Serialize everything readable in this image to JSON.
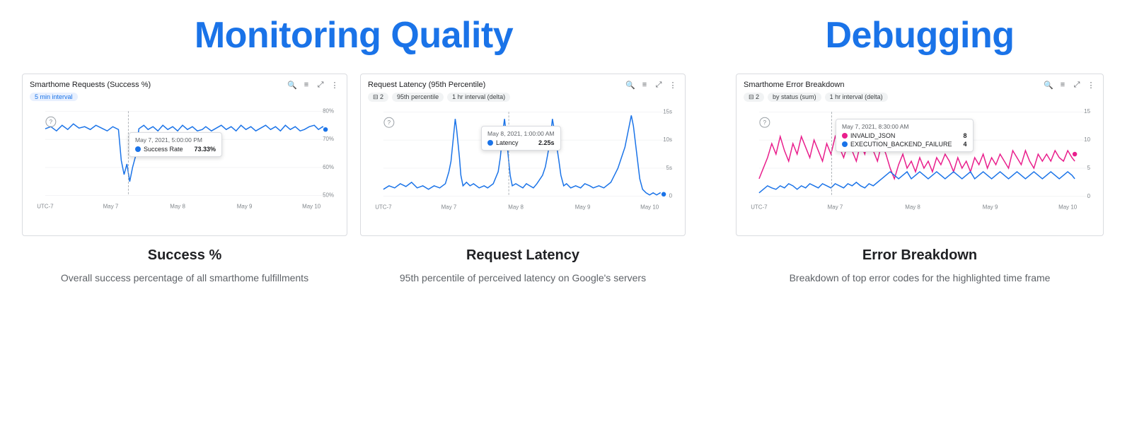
{
  "monitoring": {
    "title": "Monitoring Quality",
    "charts": [
      {
        "id": "success-rate",
        "title": "Smarthome Requests (Success %)",
        "pills": [
          "5 min interval"
        ],
        "caption_title": "Success %",
        "caption_desc": "Overall success percentage of all smarthome fulfillments",
        "tooltip_date": "May 7, 2021, 5:00:00 PM",
        "tooltip_label": "Success Rate",
        "tooltip_value": "73.33%",
        "y_labels": [
          "80%",
          "70%",
          "60%",
          "50%"
        ],
        "x_labels": [
          "UTC-7",
          "May 7",
          "May 8",
          "May 9",
          "May 10"
        ]
      },
      {
        "id": "request-latency",
        "title": "Request Latency (95th Percentile)",
        "pills": [
          "2",
          "95th percentile",
          "1 hr interval (delta)"
        ],
        "caption_title": "Request Latency",
        "caption_desc": "95th percentile of perceived latency on Google's servers",
        "tooltip_date": "May 8, 2021, 1:00:00 AM",
        "tooltip_label": "Latency",
        "tooltip_value": "2.25s",
        "y_labels": [
          "15s",
          "10s",
          "5s",
          "0"
        ],
        "x_labels": [
          "UTC-7",
          "May 7",
          "May 8",
          "May 9",
          "May 10"
        ]
      }
    ]
  },
  "debugging": {
    "title": "Debugging",
    "chart": {
      "id": "error-breakdown",
      "title": "Smarthome Error Breakdown",
      "pills": [
        "2",
        "by status (sum)",
        "1 hr interval (delta)"
      ],
      "caption_title": "Error Breakdown",
      "caption_desc": "Breakdown of top error codes for the highlighted time frame",
      "tooltip_date": "May 7, 2021, 8:30:00 AM",
      "tooltip_rows": [
        {
          "label": "INVALID_JSON",
          "value": "8",
          "color": "#e91e8c"
        },
        {
          "label": "EXECUTION_BACKEND_FAILURE",
          "value": "4",
          "color": "#1a73e8"
        }
      ],
      "y_labels": [
        "15",
        "10",
        "5",
        "0"
      ],
      "x_labels": [
        "UTC-7",
        "May 7",
        "May 8",
        "May 9",
        "May 10"
      ]
    }
  },
  "icons": {
    "search": "🔍",
    "legend": "≡",
    "expand": "⤢",
    "more": "⋮",
    "filter": "⊟"
  }
}
